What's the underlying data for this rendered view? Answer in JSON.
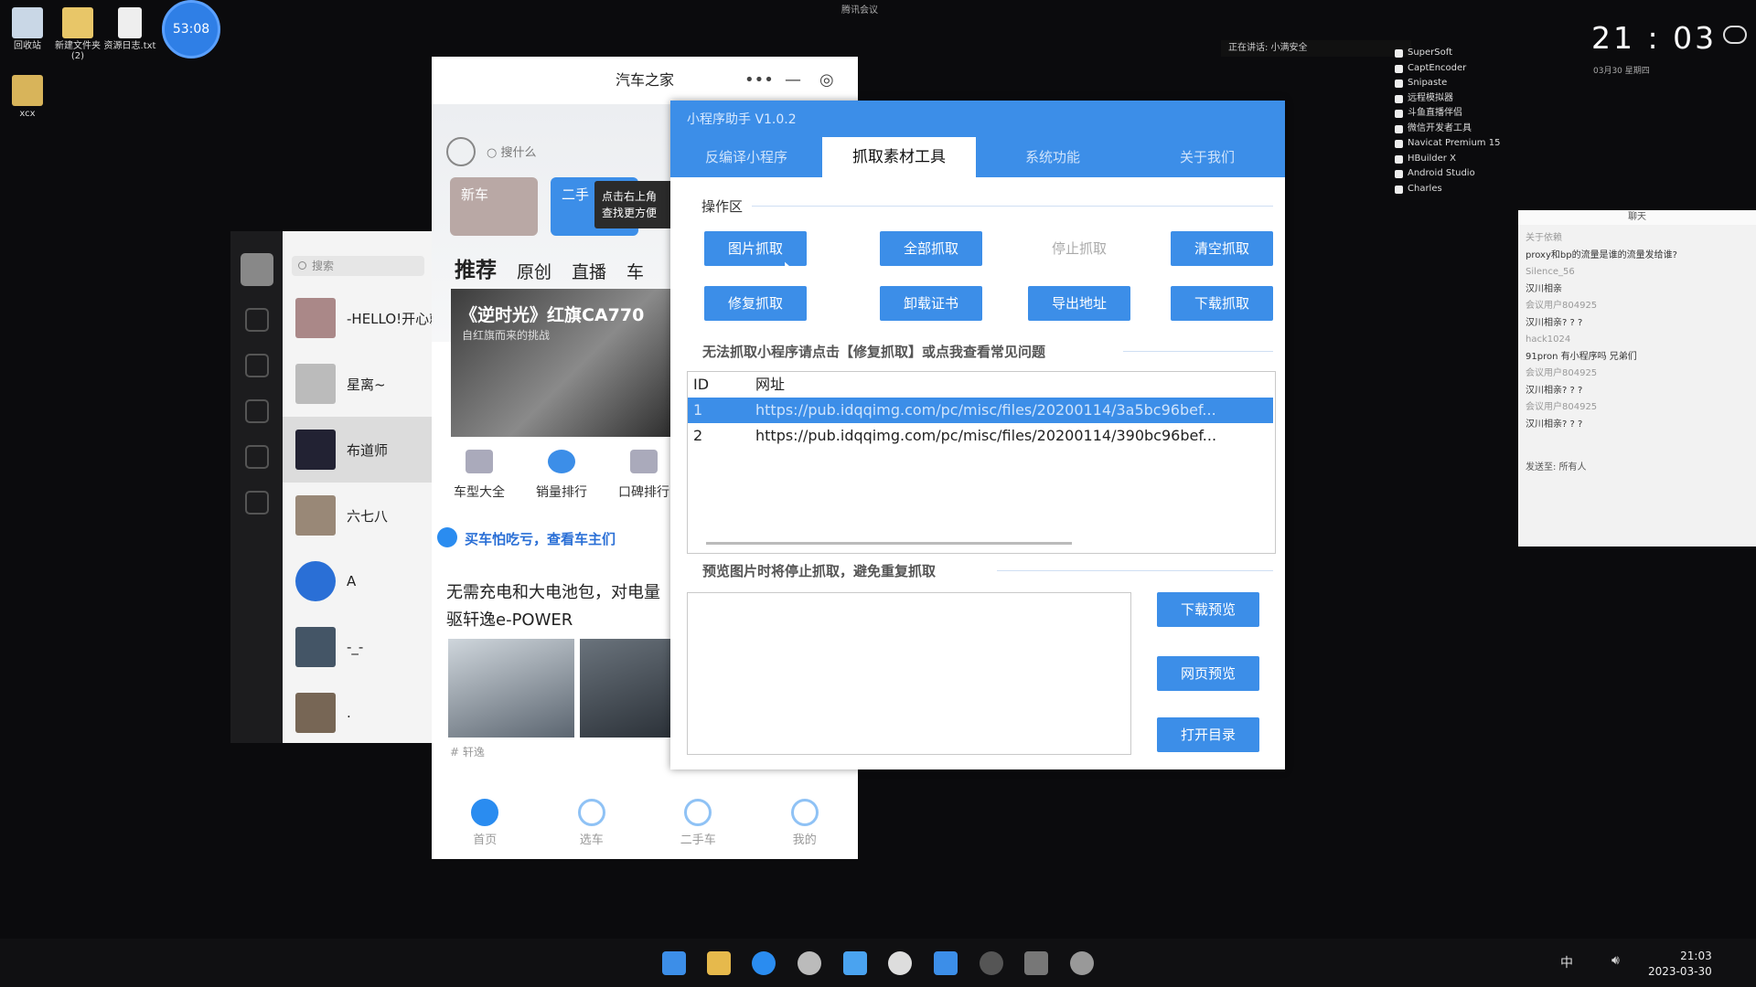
{
  "desktop": {
    "icons": [
      {
        "label": "回收站"
      },
      {
        "label": "新建文件夹 (2)"
      },
      {
        "label": "资源日志.txt"
      },
      {
        "label": "xcx"
      }
    ],
    "timer": "53:08",
    "top_center": "腾讯会议",
    "speaking": "正在讲话: 小满安全"
  },
  "wechat": {
    "search_placeholder": "搜索",
    "chats": [
      {
        "name": "-HELLO!开心就"
      },
      {
        "name": "星离~"
      },
      {
        "name": "布道师"
      },
      {
        "name": "六七八"
      },
      {
        "name": "A"
      },
      {
        "name": "-_-"
      },
      {
        "name": "."
      }
    ]
  },
  "autohome": {
    "title": "汽车之家",
    "search_placeholder": "搜什么",
    "cards": [
      "新车",
      "二手"
    ],
    "tip": "点击右上角 查找更方便",
    "tabs": [
      "推荐",
      "原创",
      "直播",
      "车"
    ],
    "banner_title": "《逆时光》红旗CA770",
    "banner_sub": "自红旗而来的挑战",
    "shortcuts": [
      "车型大全",
      "销量排行",
      "口碑排行"
    ],
    "ad_text": "买车怕吃亏，查看车主们",
    "news_title": "无需充电和大电池包，对电量 驱轩逸e-POWER",
    "news_caption": "# 轩逸",
    "bottom_nav": [
      "首页",
      "选车",
      "二手车",
      "我的"
    ]
  },
  "tool": {
    "title": "小程序助手 V1.0.2",
    "tabs": [
      "反编译小程序",
      "抓取素材工具",
      "系统功能",
      "关于我们"
    ],
    "active_tab": 1,
    "ops_label": "操作区",
    "buttons_row1": [
      "图片抓取",
      "全部抓取",
      "停止抓取",
      "清空抓取"
    ],
    "buttons_row2": [
      "修复抓取",
      "卸载证书",
      "导出地址",
      "下载抓取"
    ],
    "help_text": "无法抓取小程序请点击【修复抓取】或点我查看常见问题",
    "table_headers": [
      "ID",
      "网址"
    ],
    "rows": [
      {
        "id": "1",
        "url": "https://pub.idqqimg.com/pc/misc/files/20200114/3a5bc96bef..."
      },
      {
        "id": "2",
        "url": "https://pub.idqqimg.com/pc/misc/files/20200114/390bc96bef..."
      }
    ],
    "preview_text": "预览图片时将停止抓取，避免重复抓取",
    "preview_buttons": [
      "下载预览",
      "网页预览",
      "打开目录"
    ]
  },
  "right_panel": {
    "apps": [
      "SuperSoft",
      "CaptEncoder",
      "Snipaste",
      "远程模拟器",
      "斗鱼直播伴侣",
      "微信开发者工具",
      "Navicat Premium 15",
      "HBuilder X",
      "Android Studio",
      "Charles"
    ],
    "clock": "21 : 03",
    "date": "03月30  星期四",
    "chat_title": "聊天",
    "chat_lines": [
      {
        "t": "关于依赖",
        "m": true
      },
      {
        "t": "proxy和bp的流量是谁的流量发给谁?",
        "m": false
      },
      {
        "t": "Silence_56",
        "m": true
      },
      {
        "t": "汉川相亲",
        "m": false
      },
      {
        "t": "会议用户804925",
        "m": true
      },
      {
        "t": "汉川相亲? ? ?",
        "m": false
      },
      {
        "t": "hack1024",
        "m": true
      },
      {
        "t": "91pron 有小程序吗 兄弟们",
        "m": false
      },
      {
        "t": "会议用户804925",
        "m": true
      },
      {
        "t": "汉川相亲? ? ?",
        "m": false
      },
      {
        "t": "会议用户804925",
        "m": true
      },
      {
        "t": "汉川相亲? ? ?",
        "m": false
      }
    ],
    "chat_footer": "发送至:  所有人"
  },
  "taskbar": {
    "time": "21:03",
    "date": "2023-03-30",
    "ime": "中"
  }
}
